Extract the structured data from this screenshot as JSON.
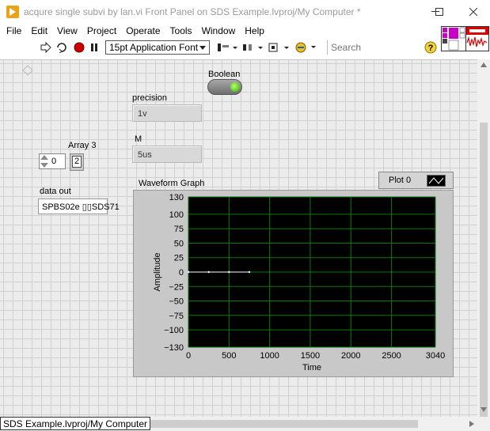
{
  "window": {
    "title": "acqure single subvi by lan.vi Front Panel on SDS Example.lvproj/My Computer *",
    "minimize": "—",
    "maximize": "☐",
    "close": "✕"
  },
  "menu": [
    "File",
    "Edit",
    "View",
    "Project",
    "Operate",
    "Tools",
    "Window",
    "Help"
  ],
  "toolbar": {
    "font": "15pt Application Font",
    "search_placeholder": "Search",
    "help": "?"
  },
  "controls": {
    "boolean_label": "Boolean",
    "precision_label": "precision",
    "precision_value": "1v",
    "m_label": "M",
    "m_value": "5us",
    "array_label": "Array 3",
    "array_index": "0",
    "array_element": "2",
    "data_out_label": "data out",
    "data_out_value": "SPBS02e ▯▯SDS71"
  },
  "graph": {
    "title": "Waveform Graph",
    "legend_plot": "Plot 0"
  },
  "chart_data": {
    "type": "line",
    "title": "Waveform Graph",
    "xlabel": "Time",
    "ylabel": "Amplitude",
    "xlim": [
      0,
      3040
    ],
    "ylim": [
      -130,
      130
    ],
    "x_ticks": [
      0,
      500,
      1000,
      1500,
      2000,
      2500,
      3040
    ],
    "y_ticks": [
      130,
      100,
      75,
      50,
      25,
      0,
      -25,
      -50,
      -75,
      -100,
      -130
    ],
    "grid": true,
    "legend": "top-right",
    "series": [
      {
        "name": "Plot 0",
        "x": [
          0,
          250,
          500,
          750
        ],
        "y": [
          0,
          0,
          0,
          0
        ]
      }
    ],
    "colors": {
      "plot_bg": "#000000",
      "grid": "#0a7a0a",
      "trace": "#ffffff"
    }
  },
  "status": {
    "path": "SDS Example.lvproj/My Computer"
  }
}
